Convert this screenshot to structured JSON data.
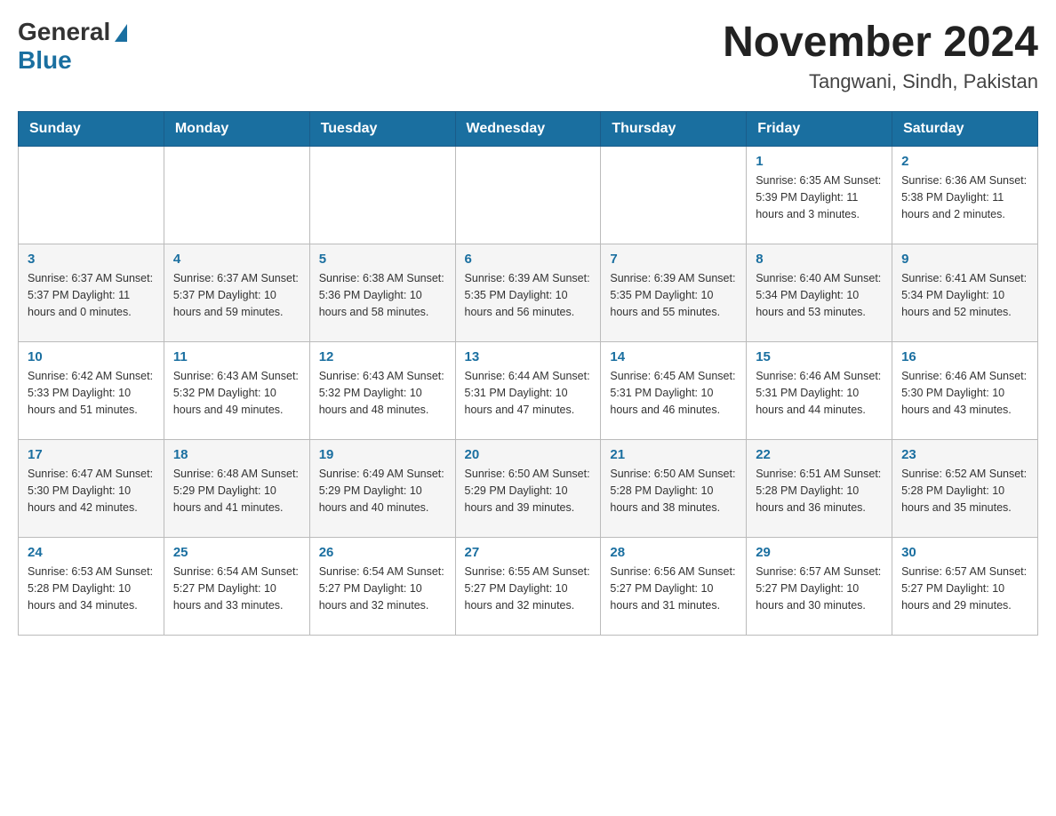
{
  "header": {
    "logo_general": "General",
    "logo_blue": "Blue",
    "title": "November 2024",
    "subtitle": "Tangwani, Sindh, Pakistan"
  },
  "weekdays": [
    "Sunday",
    "Monday",
    "Tuesday",
    "Wednesday",
    "Thursday",
    "Friday",
    "Saturday"
  ],
  "weeks": [
    [
      {
        "day": "",
        "info": ""
      },
      {
        "day": "",
        "info": ""
      },
      {
        "day": "",
        "info": ""
      },
      {
        "day": "",
        "info": ""
      },
      {
        "day": "",
        "info": ""
      },
      {
        "day": "1",
        "info": "Sunrise: 6:35 AM\nSunset: 5:39 PM\nDaylight: 11 hours and 3 minutes."
      },
      {
        "day": "2",
        "info": "Sunrise: 6:36 AM\nSunset: 5:38 PM\nDaylight: 11 hours and 2 minutes."
      }
    ],
    [
      {
        "day": "3",
        "info": "Sunrise: 6:37 AM\nSunset: 5:37 PM\nDaylight: 11 hours and 0 minutes."
      },
      {
        "day": "4",
        "info": "Sunrise: 6:37 AM\nSunset: 5:37 PM\nDaylight: 10 hours and 59 minutes."
      },
      {
        "day": "5",
        "info": "Sunrise: 6:38 AM\nSunset: 5:36 PM\nDaylight: 10 hours and 58 minutes."
      },
      {
        "day": "6",
        "info": "Sunrise: 6:39 AM\nSunset: 5:35 PM\nDaylight: 10 hours and 56 minutes."
      },
      {
        "day": "7",
        "info": "Sunrise: 6:39 AM\nSunset: 5:35 PM\nDaylight: 10 hours and 55 minutes."
      },
      {
        "day": "8",
        "info": "Sunrise: 6:40 AM\nSunset: 5:34 PM\nDaylight: 10 hours and 53 minutes."
      },
      {
        "day": "9",
        "info": "Sunrise: 6:41 AM\nSunset: 5:34 PM\nDaylight: 10 hours and 52 minutes."
      }
    ],
    [
      {
        "day": "10",
        "info": "Sunrise: 6:42 AM\nSunset: 5:33 PM\nDaylight: 10 hours and 51 minutes."
      },
      {
        "day": "11",
        "info": "Sunrise: 6:43 AM\nSunset: 5:32 PM\nDaylight: 10 hours and 49 minutes."
      },
      {
        "day": "12",
        "info": "Sunrise: 6:43 AM\nSunset: 5:32 PM\nDaylight: 10 hours and 48 minutes."
      },
      {
        "day": "13",
        "info": "Sunrise: 6:44 AM\nSunset: 5:31 PM\nDaylight: 10 hours and 47 minutes."
      },
      {
        "day": "14",
        "info": "Sunrise: 6:45 AM\nSunset: 5:31 PM\nDaylight: 10 hours and 46 minutes."
      },
      {
        "day": "15",
        "info": "Sunrise: 6:46 AM\nSunset: 5:31 PM\nDaylight: 10 hours and 44 minutes."
      },
      {
        "day": "16",
        "info": "Sunrise: 6:46 AM\nSunset: 5:30 PM\nDaylight: 10 hours and 43 minutes."
      }
    ],
    [
      {
        "day": "17",
        "info": "Sunrise: 6:47 AM\nSunset: 5:30 PM\nDaylight: 10 hours and 42 minutes."
      },
      {
        "day": "18",
        "info": "Sunrise: 6:48 AM\nSunset: 5:29 PM\nDaylight: 10 hours and 41 minutes."
      },
      {
        "day": "19",
        "info": "Sunrise: 6:49 AM\nSunset: 5:29 PM\nDaylight: 10 hours and 40 minutes."
      },
      {
        "day": "20",
        "info": "Sunrise: 6:50 AM\nSunset: 5:29 PM\nDaylight: 10 hours and 39 minutes."
      },
      {
        "day": "21",
        "info": "Sunrise: 6:50 AM\nSunset: 5:28 PM\nDaylight: 10 hours and 38 minutes."
      },
      {
        "day": "22",
        "info": "Sunrise: 6:51 AM\nSunset: 5:28 PM\nDaylight: 10 hours and 36 minutes."
      },
      {
        "day": "23",
        "info": "Sunrise: 6:52 AM\nSunset: 5:28 PM\nDaylight: 10 hours and 35 minutes."
      }
    ],
    [
      {
        "day": "24",
        "info": "Sunrise: 6:53 AM\nSunset: 5:28 PM\nDaylight: 10 hours and 34 minutes."
      },
      {
        "day": "25",
        "info": "Sunrise: 6:54 AM\nSunset: 5:27 PM\nDaylight: 10 hours and 33 minutes."
      },
      {
        "day": "26",
        "info": "Sunrise: 6:54 AM\nSunset: 5:27 PM\nDaylight: 10 hours and 32 minutes."
      },
      {
        "day": "27",
        "info": "Sunrise: 6:55 AM\nSunset: 5:27 PM\nDaylight: 10 hours and 32 minutes."
      },
      {
        "day": "28",
        "info": "Sunrise: 6:56 AM\nSunset: 5:27 PM\nDaylight: 10 hours and 31 minutes."
      },
      {
        "day": "29",
        "info": "Sunrise: 6:57 AM\nSunset: 5:27 PM\nDaylight: 10 hours and 30 minutes."
      },
      {
        "day": "30",
        "info": "Sunrise: 6:57 AM\nSunset: 5:27 PM\nDaylight: 10 hours and 29 minutes."
      }
    ]
  ]
}
